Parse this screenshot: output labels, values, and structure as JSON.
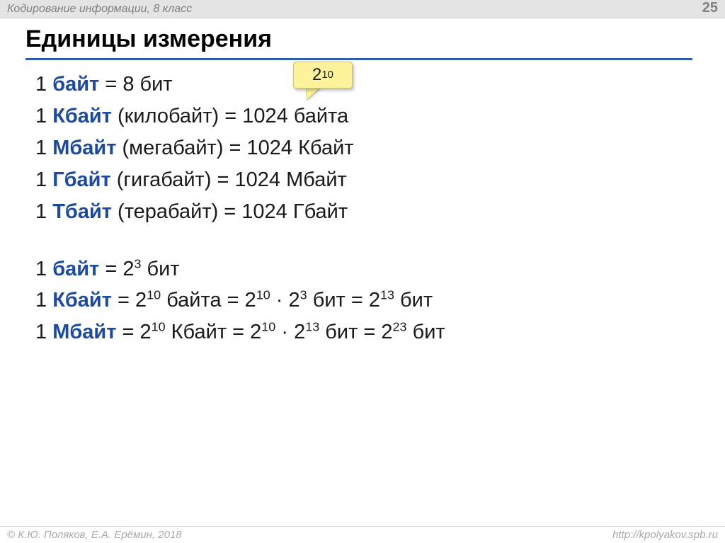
{
  "header": {
    "left": "Кодирование информации, 8 класс",
    "page": "25"
  },
  "title": "Единицы измерения",
  "callout": {
    "base": "2",
    "exp": "10"
  },
  "lines1": [
    {
      "prefix": "1 ",
      "unit": "байт",
      "rest": " = 8 бит"
    },
    {
      "prefix": "1 ",
      "unit": "Кбайт",
      "rest": " (килобайт) = 1024 байта"
    },
    {
      "prefix": "1 ",
      "unit": "Мбайт",
      "rest": " (мегабайт) = 1024 Кбайт"
    },
    {
      "prefix": "1 ",
      "unit": "Гбайт",
      "rest": " (гигабайт) = 1024 Мбайт"
    },
    {
      "prefix": "1 ",
      "unit": "Тбайт",
      "rest": " (терабайт) = 1024 Гбайт"
    }
  ],
  "lines2": [
    {
      "prefix": "1 ",
      "unit": "байт",
      "parts": [
        {
          "t": " = 2"
        },
        {
          "sup": "3"
        },
        {
          "t": " бит"
        }
      ]
    },
    {
      "prefix": "1 ",
      "unit": "Кбайт",
      "parts": [
        {
          "t": " = 2"
        },
        {
          "sup": "10"
        },
        {
          "t": " байта = 2"
        },
        {
          "sup": "10"
        },
        {
          "t": " · 2"
        },
        {
          "sup": "3"
        },
        {
          "t": " бит = 2"
        },
        {
          "sup": "13"
        },
        {
          "t": " бит"
        }
      ]
    },
    {
      "prefix": "1 ",
      "unit": "Мбайт",
      "parts": [
        {
          "t": " = 2"
        },
        {
          "sup": "10"
        },
        {
          "t": " Кбайт = 2"
        },
        {
          "sup": "10"
        },
        {
          "t": " · 2"
        },
        {
          "sup": "13"
        },
        {
          "t": "  бит = 2"
        },
        {
          "sup": "23"
        },
        {
          "t": " бит"
        }
      ]
    }
  ],
  "footer": {
    "left": "© К.Ю. Поляков, Е.А. Ерёмин, 2018",
    "right": "http://kpolyakov.spb.ru"
  }
}
